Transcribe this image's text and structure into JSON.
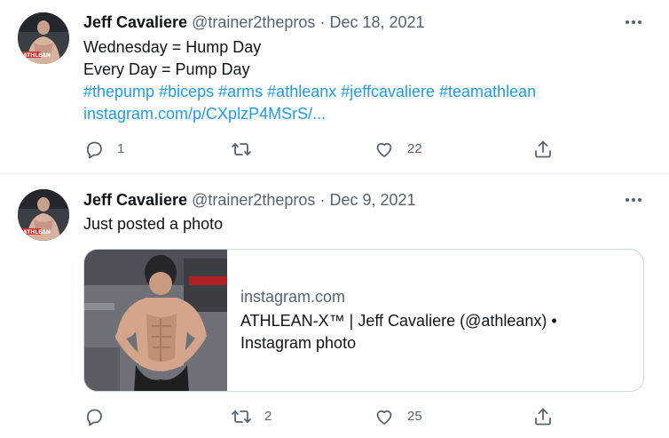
{
  "tweets": [
    {
      "author": {
        "name": "Jeff Cavaliere",
        "handle": "@trainer2thepros",
        "avatar_icon": "profile-photo"
      },
      "separator": "·",
      "date": "Dec 18, 2021",
      "text_lines": [
        "Wednesday = Hump Day",
        "Every Day = Pump Day"
      ],
      "hashtags": [
        "#thepump",
        "#biceps",
        "#arms",
        "#athleanx",
        "#jeffcavaliere",
        "#teamathlean"
      ],
      "link": "instagram.com/p/CXplzP4MSrS/...",
      "actions": {
        "replies": "1",
        "retweets": "",
        "likes": "22"
      }
    },
    {
      "author": {
        "name": "Jeff Cavaliere",
        "handle": "@trainer2thepros",
        "avatar_icon": "profile-photo"
      },
      "separator": "·",
      "date": "Dec 9, 2021",
      "text_lines": [
        "Just posted a photo"
      ],
      "card": {
        "domain": "instagram.com",
        "title": "ATHLEAN-X™ | Jeff Cavaliere (@athleanx) • Instagram photo",
        "image_icon": "gym-photo"
      },
      "actions": {
        "replies": "",
        "retweets": "2",
        "likes": "25"
      }
    }
  ],
  "colors": {
    "link": "#1d9bf0",
    "secondary_text": "#536471",
    "primary_text": "#0f1419",
    "border": "#cfd9de"
  },
  "icons": {
    "more": "more-icon",
    "reply": "reply-icon",
    "retweet": "retweet-icon",
    "like": "like-icon",
    "share": "share-icon"
  }
}
